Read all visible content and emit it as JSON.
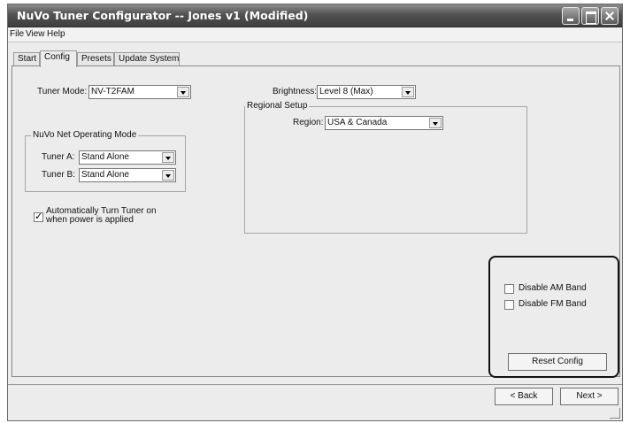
{
  "window": {
    "title": "NuVo Tuner Configurator -- Jones v1 (Modified)"
  },
  "menu": {
    "file": "File",
    "view": "View",
    "help": "Help"
  },
  "tabs": [
    {
      "label": "Start"
    },
    {
      "label": "Config"
    },
    {
      "label": "Presets"
    },
    {
      "label": "Update System"
    }
  ],
  "config": {
    "tuner_mode_label": "Tuner Mode:",
    "tuner_mode_value": "NV-T2FAM",
    "net_mode_group": "NuVo Net Operating Mode",
    "tuner_a_label": "Tuner A:",
    "tuner_a_value": "Stand Alone",
    "tuner_b_label": "Tuner B:",
    "tuner_b_value": "Stand Alone",
    "auto_on_label_1": "Automatically Turn Tuner on",
    "auto_on_label_2": "when power is applied",
    "auto_on_checked": true,
    "brightness_label": "Brightness:",
    "brightness_value": "Level 8 (Max)",
    "regional_group": "Regional Setup",
    "region_label": "Region:",
    "region_value": "USA & Canada",
    "disable_am_label": "Disable AM Band",
    "disable_fm_label": "Disable FM Band",
    "reset_label": "Reset Config"
  },
  "nav": {
    "back_label": "< Back",
    "next_label": "Next >"
  },
  "icons": [
    "minimize-icon",
    "maximize-icon",
    "close-icon",
    "chevron-down-icon",
    "checkmark-icon",
    "resize-grip-icon"
  ]
}
